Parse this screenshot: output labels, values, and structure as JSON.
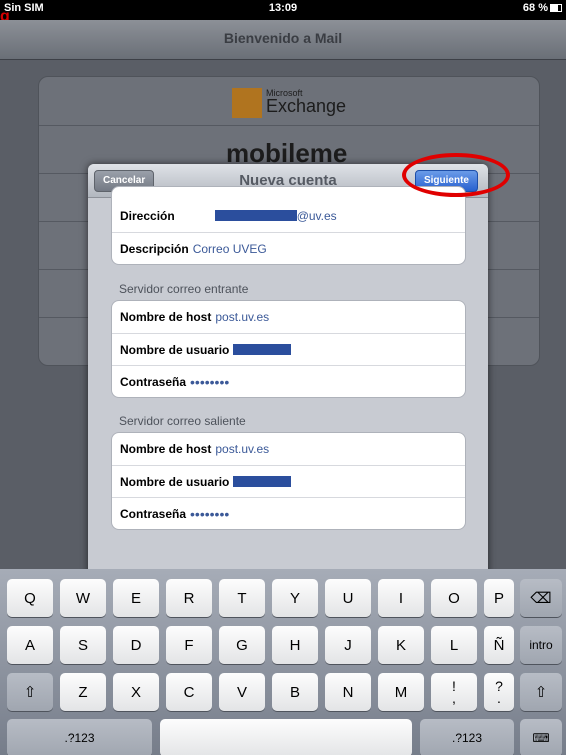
{
  "status_bar": {
    "carrier": "Sin SIM",
    "time": "13:09",
    "battery": "68 %"
  },
  "background": {
    "title": "Bienvenido a Mail",
    "exchange_small": "Microsoft",
    "exchange_large": "Exchange",
    "mobileme": "mobileme"
  },
  "modal": {
    "title": "Nueva cuenta",
    "cancel_label": "Cancelar",
    "next_label": "Siguiente",
    "account": {
      "address_label": "Dirección",
      "address_domain": "@uv.es",
      "description_label": "Descripción",
      "description_value": "Correo UVEG"
    },
    "incoming": {
      "header": "Servidor correo entrante",
      "host_label": "Nombre de host",
      "host_value": "post.uv.es",
      "user_label": "Nombre de usuario",
      "password_label": "Contraseña",
      "password_value": "••••••••"
    },
    "outgoing": {
      "header": "Servidor correo saliente",
      "host_label": "Nombre de host",
      "host_value": "post.uv.es",
      "user_label": "Nombre de usuario",
      "password_label": "Contraseña",
      "password_value": "••••••••"
    }
  },
  "keyboard": {
    "row1": [
      "Q",
      "W",
      "E",
      "R",
      "T",
      "Y",
      "U",
      "I",
      "O",
      "P"
    ],
    "row2": [
      "A",
      "S",
      "D",
      "F",
      "G",
      "H",
      "J",
      "K",
      "L",
      "Ñ"
    ],
    "row3": [
      "Z",
      "X",
      "C",
      "V",
      "B",
      "N",
      "M"
    ],
    "return_label": "intro",
    "numbers_label": ".?123",
    "punct1": [
      "!",
      ","
    ],
    "punct2": [
      "?",
      "."
    ]
  }
}
